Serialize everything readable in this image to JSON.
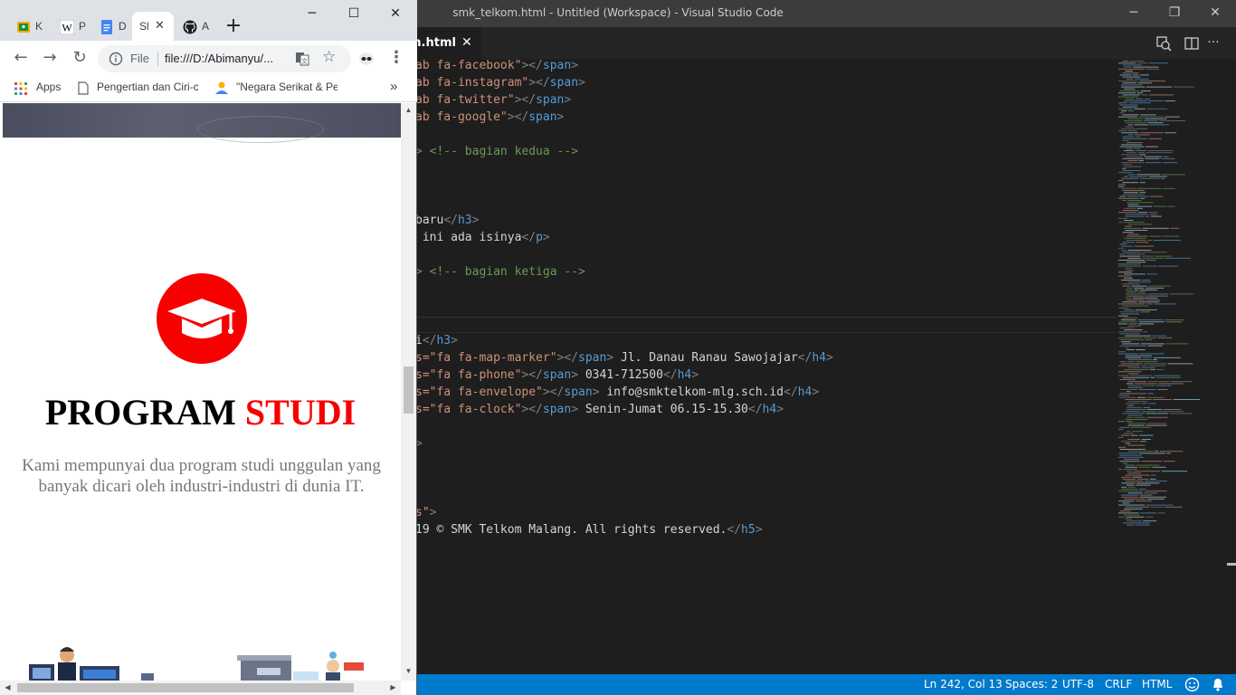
{
  "vscode": {
    "window_title": "smk_telkom.html - Untitled (Workspace) - Visual Studio Code",
    "tab_label": "m.html",
    "tab_close": "✕",
    "code_lines": [
      {
        "line": 0,
        "segments": [
          {
            "c": "str",
            "t": "ab fa-facebook\""
          },
          {
            "c": "tag",
            "t": ">"
          },
          {
            "c": "tag",
            "t": "</"
          },
          {
            "c": "tname",
            "t": "span"
          },
          {
            "c": "tag",
            "t": ">"
          }
        ]
      },
      {
        "line": 1,
        "segments": [
          {
            "c": "str",
            "t": "ab fa-instagram\""
          },
          {
            "c": "tag",
            "t": ">"
          },
          {
            "c": "tag",
            "t": "</"
          },
          {
            "c": "tname",
            "t": "span"
          },
          {
            "c": "tag",
            "t": ">"
          }
        ]
      },
      {
        "line": 2,
        "segments": [
          {
            "c": "str",
            "t": "ab fa-twitter\""
          },
          {
            "c": "tag",
            "t": ">"
          },
          {
            "c": "tag",
            "t": "</"
          },
          {
            "c": "tname",
            "t": "span"
          },
          {
            "c": "tag",
            "t": ">"
          }
        ]
      },
      {
        "line": 3,
        "segments": [
          {
            "c": "str",
            "t": "ab fa-google\""
          },
          {
            "c": "tag",
            "t": ">"
          },
          {
            "c": "tag",
            "t": "</"
          },
          {
            "c": "tname",
            "t": "span"
          },
          {
            "c": "tag",
            "t": ">"
          }
        ]
      },
      {
        "line": 5,
        "segments": [
          {
            "c": "tag",
            "t": "> "
          },
          {
            "c": "cmt",
            "t": "<!-- bagian kedua -->"
          }
        ]
      },
      {
        "line": 9,
        "segments": [
          {
            "c": "plain",
            "t": "baru"
          },
          {
            "c": "tag",
            "t": "</"
          },
          {
            "c": "tname",
            "t": "h3"
          },
          {
            "c": "tag",
            "t": ">"
          }
        ]
      },
      {
        "line": 10,
        "segments": [
          {
            "c": "plain",
            "t": " ini ada isinya"
          },
          {
            "c": "tag",
            "t": "</"
          },
          {
            "c": "tname",
            "t": "p"
          },
          {
            "c": "tag",
            "t": ">"
          }
        ]
      },
      {
        "line": 12,
        "segments": [
          {
            "c": "tag",
            "t": "> "
          },
          {
            "c": "cmt",
            "t": "<!-- bagian ketiga -->"
          }
        ]
      },
      {
        "line": 16,
        "segments": [
          {
            "c": "plain",
            "t": "i"
          },
          {
            "c": "tag",
            "t": "</"
          },
          {
            "c": "tname",
            "t": "h3"
          },
          {
            "c": "tag",
            "t": ">"
          }
        ]
      },
      {
        "line": 17,
        "segments": [
          {
            "c": "str",
            "t": "s=\"fa fa-map-marker\""
          },
          {
            "c": "tag",
            "t": ">"
          },
          {
            "c": "tag",
            "t": "</"
          },
          {
            "c": "tname",
            "t": "span"
          },
          {
            "c": "tag",
            "t": ">"
          },
          {
            "c": "plain",
            "t": " Jl. Danau Ranau Sawojajar"
          },
          {
            "c": "tag",
            "t": "</"
          },
          {
            "c": "tname",
            "t": "h4"
          },
          {
            "c": "tag",
            "t": ">"
          }
        ]
      },
      {
        "line": 18,
        "segments": [
          {
            "c": "str",
            "t": "s=\"fa fa-phone\""
          },
          {
            "c": "tag",
            "t": ">"
          },
          {
            "c": "tag",
            "t": "</"
          },
          {
            "c": "tname",
            "t": "span"
          },
          {
            "c": "tag",
            "t": ">"
          },
          {
            "c": "plain",
            "t": " 0341-712500"
          },
          {
            "c": "tag",
            "t": "</"
          },
          {
            "c": "tname",
            "t": "h4"
          },
          {
            "c": "tag",
            "t": ">"
          }
        ]
      },
      {
        "line": 19,
        "segments": [
          {
            "c": "str",
            "t": "s=\"fa fa-envelope\""
          },
          {
            "c": "tag",
            "t": ">"
          },
          {
            "c": "tag",
            "t": "</"
          },
          {
            "c": "tname",
            "t": "span"
          },
          {
            "c": "tag",
            "t": ">"
          },
          {
            "c": "plain",
            "t": " info@smktelkom-mlg.sch.id"
          },
          {
            "c": "tag",
            "t": "</"
          },
          {
            "c": "tname",
            "t": "h4"
          },
          {
            "c": "tag",
            "t": ">"
          }
        ]
      },
      {
        "line": 20,
        "segments": [
          {
            "c": "str",
            "t": "s=\"fa fa-clock\""
          },
          {
            "c": "tag",
            "t": ">"
          },
          {
            "c": "tag",
            "t": "</"
          },
          {
            "c": "tname",
            "t": "span"
          },
          {
            "c": "tag",
            "t": ">"
          },
          {
            "c": "plain",
            "t": " Senin-Jumat 06.15-15.30"
          },
          {
            "c": "tag",
            "t": "</"
          },
          {
            "c": "tname",
            "t": "h4"
          },
          {
            "c": "tag",
            "t": ">"
          }
        ]
      },
      {
        "line": 22,
        "segments": [
          {
            "c": "tag",
            "t": ">"
          }
        ]
      },
      {
        "line": 26,
        "segments": [
          {
            "c": "str",
            "t": "s\""
          },
          {
            "c": "tag",
            "t": ">"
          }
        ]
      },
      {
        "line": 27,
        "segments": [
          {
            "c": "plain",
            "t": "19 © SMK Telkom Malang. All rights reserved."
          },
          {
            "c": "tag",
            "t": "</"
          },
          {
            "c": "tname",
            "t": "h5"
          },
          {
            "c": "tag",
            "t": ">"
          }
        ]
      }
    ],
    "status": {
      "position": "Ln 242, Col 13",
      "spaces": "Spaces: 2",
      "encoding": "UTF-8",
      "eol": "CRLF",
      "language": "HTML"
    }
  },
  "chrome": {
    "tabs": [
      {
        "label": "K",
        "icon": "google-classroom-icon"
      },
      {
        "label": "P",
        "icon": "wikipedia-icon"
      },
      {
        "label": "D",
        "icon": "google-docs-icon"
      },
      {
        "label": "Sl",
        "icon": "page-icon",
        "active": true
      },
      {
        "label": "A",
        "icon": "github-icon"
      }
    ],
    "new_tab": "+",
    "address": {
      "scheme": "File",
      "url": "file:///D:/Abimanyu/..."
    },
    "bookmarks": {
      "apps": "Apps",
      "item1": "Pengertian dan Ciri-ci",
      "item2": "\"Negara Serikat & Pe",
      "overflow": "»"
    },
    "page": {
      "title_main": "PROGRAM ",
      "title_accent": "STUDI",
      "description": "Kami mempunyai dua program studi unggulan yang banyak dicari oleh industri-industri di dunia IT."
    },
    "colors": {
      "accent": "#f70000"
    }
  }
}
